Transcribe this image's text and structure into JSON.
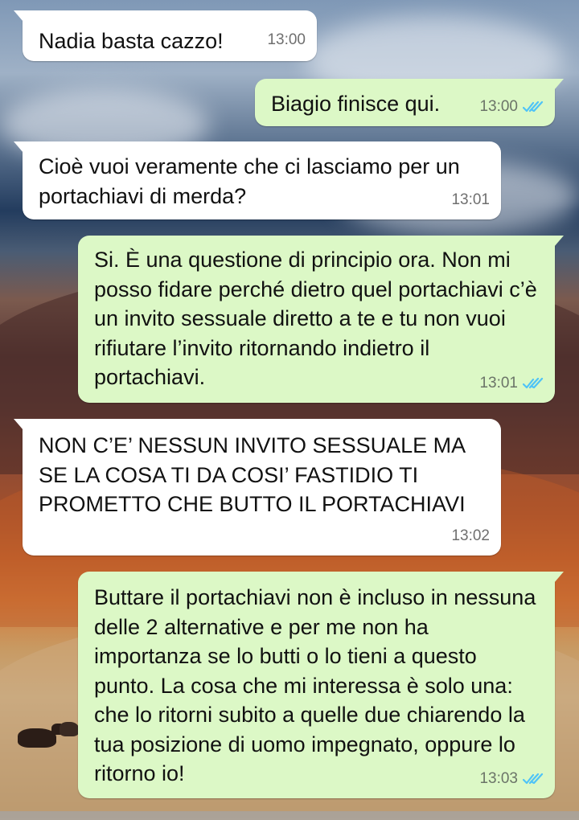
{
  "chat": {
    "messages": [
      {
        "direction": "incoming",
        "text": "Nadia basta cazzo!",
        "time": "13:00"
      },
      {
        "direction": "outgoing",
        "text": "Biagio finisce qui.",
        "time": "13:00",
        "status": "read"
      },
      {
        "direction": "incoming",
        "text": "Cioè vuoi veramente che ci lasciamo per un portachiavi di merda?",
        "time": "13:01"
      },
      {
        "direction": "outgoing",
        "text": "Si. È una questione di principio ora. Non mi posso fidare perché dietro quel portachiavi c’è un invito sessuale diretto a te e tu non vuoi rifiutare l’invito ritornando indietro il portachiavi.",
        "time": "13:01",
        "status": "read"
      },
      {
        "direction": "incoming",
        "text": "NON C’E’ NESSUN INVITO SESSUALE MA SE LA COSA TI DA COSI’ FASTIDIO TI PROMETTO CHE BUTTO IL PORTACHIAVI",
        "time": "13:02"
      },
      {
        "direction": "outgoing",
        "text": "Buttare il portachiavi non è incluso in nessuna delle 2 alternative e per me non ha importanza se lo butti o lo tieni a questo punto. La cosa che mi interessa è solo una: che lo ritorni subito a quelle due chiarendo la tua posizione di uomo impegnato, oppure lo ritorno io!",
        "time": "13:03",
        "status": "read"
      }
    ]
  },
  "colors": {
    "incoming_bubble": "#ffffff",
    "outgoing_bubble": "#dcf8c6",
    "read_ticks": "#4fc3f7"
  },
  "icons": {
    "read_status": "double-check-icon"
  }
}
